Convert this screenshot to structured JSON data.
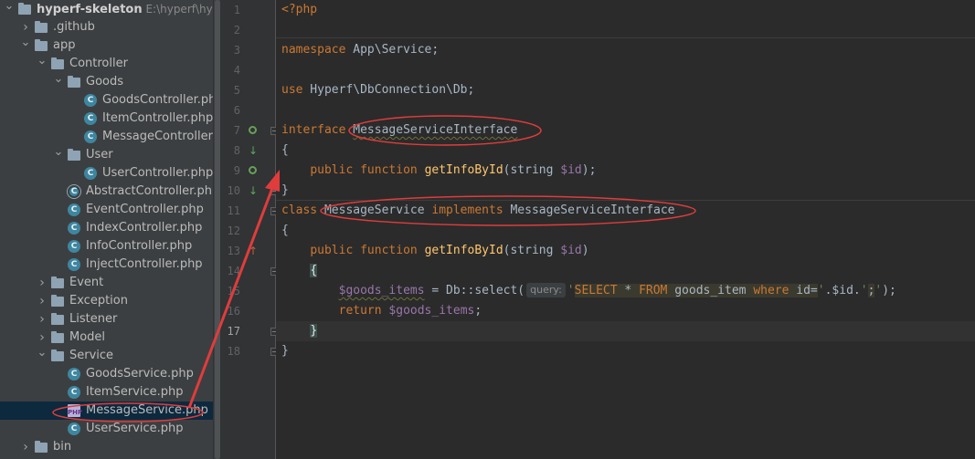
{
  "project_tree": {
    "items": [
      {
        "label": "hyperf-skeleton",
        "path": "E:\\hyperf\\hyperf-s",
        "kind": "root",
        "depth": 0,
        "expanded": true
      },
      {
        "label": ".github",
        "kind": "folder",
        "depth": 1,
        "expanded": false
      },
      {
        "label": "app",
        "kind": "folder",
        "depth": 1,
        "expanded": true
      },
      {
        "label": "Controller",
        "kind": "folder",
        "depth": 2,
        "expanded": true
      },
      {
        "label": "Goods",
        "kind": "folder",
        "depth": 3,
        "expanded": true
      },
      {
        "label": "GoodsController.php",
        "kind": "class",
        "depth": 4
      },
      {
        "label": "ItemController.php",
        "kind": "class",
        "depth": 4
      },
      {
        "label": "MessageController.php",
        "kind": "class",
        "depth": 4
      },
      {
        "label": "User",
        "kind": "folder",
        "depth": 3,
        "expanded": true
      },
      {
        "label": "UserController.php",
        "kind": "class",
        "depth": 4
      },
      {
        "label": "AbstractController.php",
        "kind": "abstract",
        "depth": 3
      },
      {
        "label": "EventController.php",
        "kind": "class",
        "depth": 3
      },
      {
        "label": "IndexController.php",
        "kind": "class",
        "depth": 3
      },
      {
        "label": "InfoController.php",
        "kind": "class",
        "depth": 3
      },
      {
        "label": "InjectController.php",
        "kind": "class",
        "depth": 3
      },
      {
        "label": "Event",
        "kind": "folder",
        "depth": 2,
        "expanded": false
      },
      {
        "label": "Exception",
        "kind": "folder",
        "depth": 2,
        "expanded": false
      },
      {
        "label": "Listener",
        "kind": "folder",
        "depth": 2,
        "expanded": false
      },
      {
        "label": "Model",
        "kind": "folder",
        "depth": 2,
        "expanded": false
      },
      {
        "label": "Service",
        "kind": "folder",
        "depth": 2,
        "expanded": true
      },
      {
        "label": "GoodsService.php",
        "kind": "class",
        "depth": 3
      },
      {
        "label": "ItemService.php",
        "kind": "class",
        "depth": 3
      },
      {
        "label": "MessageService.php",
        "kind": "php",
        "depth": 3,
        "selected": true
      },
      {
        "label": "UserService.php",
        "kind": "class",
        "depth": 3
      },
      {
        "label": "bin",
        "kind": "folder",
        "depth": 1,
        "expanded": false
      }
    ]
  },
  "editor": {
    "line_numbers": [
      "1",
      "2",
      "3",
      "4",
      "5",
      "6",
      "7",
      "8",
      "9",
      "10",
      "11",
      "12",
      "13",
      "14",
      "15",
      "16",
      "17",
      "18"
    ],
    "current_line": 17,
    "code": {
      "l1": "<?php",
      "l3_kw": "namespace",
      "l3_rest": " App\\Service;",
      "l5_kw": "use",
      "l5_rest": " Hyperf\\DbConnection\\Db;",
      "l7_kw": "interface",
      "l7_name": "MessageServiceInterface",
      "l8": "{",
      "l9_public": "public",
      "l9_function": "function",
      "l9_fn": "getInfoById",
      "l9_open": "(string ",
      "l9_var": "$id",
      "l9_close": ");",
      "l10": "}",
      "l11_kw": "class",
      "l11_name": "MessageService",
      "l11_impl": "implements",
      "l11_iface": "MessageServiceInterface",
      "l12": "{",
      "l13_public": "public",
      "l13_function": "function",
      "l13_fn": "getInfoById",
      "l13_open": "(string ",
      "l13_var": "$id",
      "l13_close": ")",
      "l14": "{",
      "l15_var": "$goods_items",
      "l15_mid": " = Db::select(",
      "l15_hint": "query:",
      "l15_q1": "'",
      "l15_select": "SELECT",
      "l15_star": " * ",
      "l15_from": "FROM",
      "l15_table": " goods_item ",
      "l15_where": "where",
      "l15_col": " id=",
      "l15_q2": "'",
      "l15_concat": ".$id.",
      "l15_q3": "'",
      "l15_semi": ";",
      "l15_q4": "'",
      "l15_end": ");",
      "l16_kw": "return",
      "l16_var": "$goods_items",
      "l16_end": ";",
      "l17": "}",
      "l18": "}"
    }
  },
  "annotations": {
    "color": "#e03c3c",
    "ellipses": [
      "interface-name-highlight",
      "class-declaration-highlight",
      "selected-file-highlight"
    ],
    "arrow": "selected-file-to-code-arrow"
  }
}
